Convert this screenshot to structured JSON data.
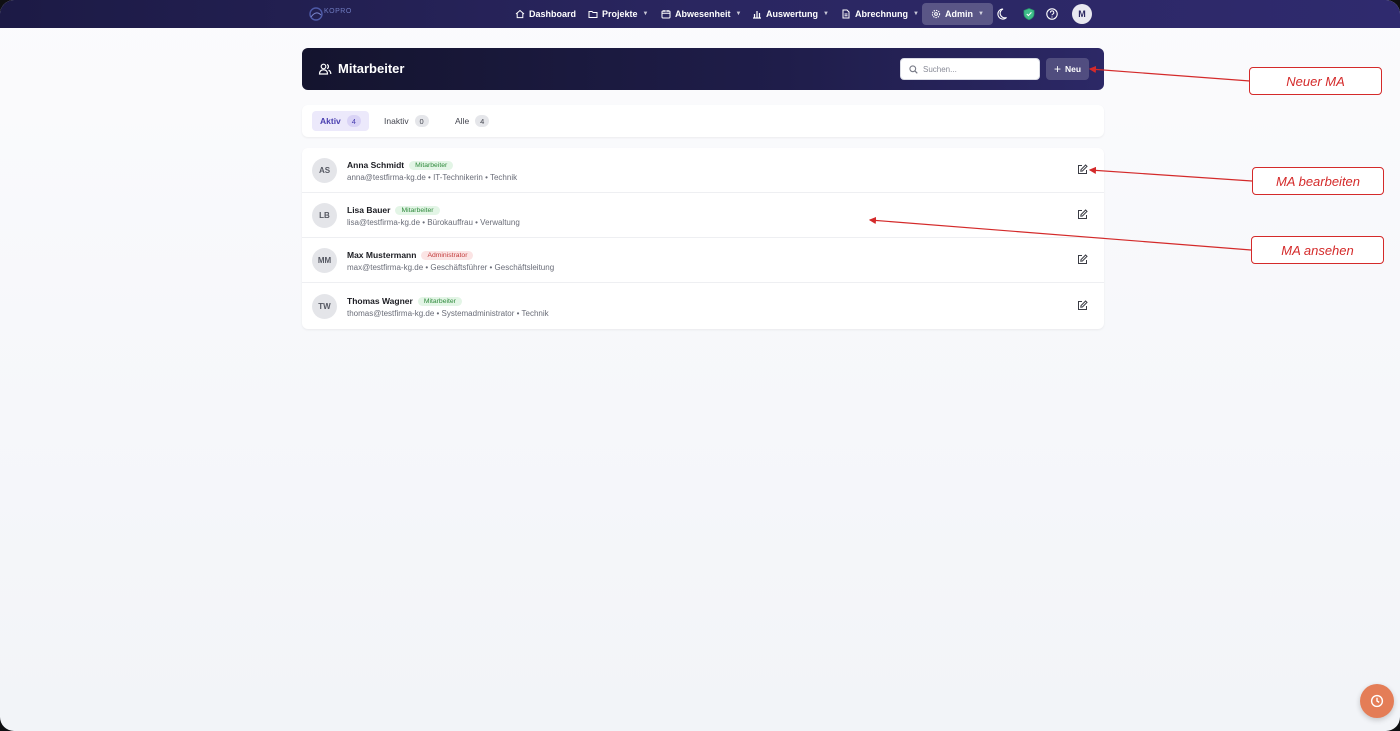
{
  "navbar": {
    "logo_text": "KOPRO",
    "items": [
      {
        "label": "Dashboard",
        "icon": "home-icon",
        "dropdown": false
      },
      {
        "label": "Projekte",
        "icon": "folder-icon",
        "dropdown": true
      },
      {
        "label": "Abwesenheit",
        "icon": "calendar-icon",
        "dropdown": true
      },
      {
        "label": "Auswertung",
        "icon": "bar-chart-icon",
        "dropdown": true
      },
      {
        "label": "Abrechnung",
        "icon": "document-icon",
        "dropdown": true
      },
      {
        "label": "Admin",
        "icon": "gear-icon",
        "dropdown": true,
        "active": true
      }
    ],
    "user_initial": "M"
  },
  "header": {
    "title": "Mitarbeiter",
    "search_placeholder": "Suchen...",
    "new_button_label": "Neu"
  },
  "tabs": [
    {
      "label": "Aktiv",
      "count": "4",
      "active": true
    },
    {
      "label": "Inaktiv",
      "count": "0",
      "active": false
    },
    {
      "label": "Alle",
      "count": "4",
      "active": false
    }
  ],
  "employees": [
    {
      "initials": "AS",
      "name": "Anna Schmidt",
      "role": "Mitarbeiter",
      "role_color": "green",
      "details": "anna@testfirma-kg.de • IT-Technikerin • Technik"
    },
    {
      "initials": "LB",
      "name": "Lisa Bauer",
      "role": "Mitarbeiter",
      "role_color": "green",
      "details": "lisa@testfirma-kg.de • Bürokauffrau • Verwaltung"
    },
    {
      "initials": "MM",
      "name": "Max Mustermann",
      "role": "Administrator",
      "role_color": "red",
      "details": "max@testfirma-kg.de • Geschäftsführer • Geschäftsleitung"
    },
    {
      "initials": "TW",
      "name": "Thomas Wagner",
      "role": "Mitarbeiter",
      "role_color": "green",
      "details": "thomas@testfirma-kg.de • Systemadministrator • Technik"
    }
  ],
  "annotations": {
    "new_employee": "Neuer MA",
    "edit_employee": "MA bearbeiten",
    "view_employee": "MA ansehen"
  },
  "colors": {
    "navbar": "#2a2660",
    "accent": "#4a3fb0",
    "annotation": "#d42a2a",
    "fab": "#e47d57"
  }
}
